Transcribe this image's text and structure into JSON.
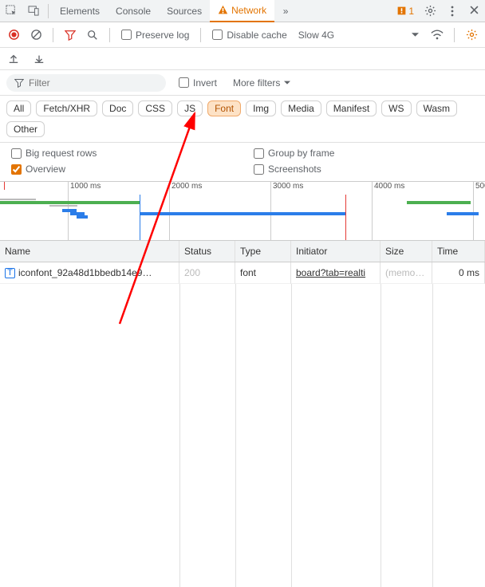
{
  "tabs": {
    "items": [
      "Elements",
      "Console",
      "Sources",
      "Network"
    ],
    "active": "Network",
    "more_icon": "»"
  },
  "issues": {
    "count": "1"
  },
  "toolbar": {
    "preserve_log": "Preserve log",
    "disable_cache": "Disable cache",
    "throttle": "Slow 4G"
  },
  "filter": {
    "placeholder": "Filter",
    "invert": "Invert",
    "more": "More filters"
  },
  "chips": [
    "All",
    "Fetch/XHR",
    "Doc",
    "CSS",
    "JS",
    "Font",
    "Img",
    "Media",
    "Manifest",
    "WS",
    "Wasm",
    "Other"
  ],
  "chip_active": "Font",
  "opts": {
    "big_rows": "Big request rows",
    "overview": "Overview",
    "group_frame": "Group by frame",
    "screenshots": "Screenshots"
  },
  "ruler": [
    "1000 ms",
    "2000 ms",
    "3000 ms",
    "4000 ms",
    "500"
  ],
  "columns": [
    "Name",
    "Status",
    "Type",
    "Initiator",
    "Size",
    "Time"
  ],
  "row": {
    "name": "iconfont_92a48d1bbedb14e9…",
    "status": "200",
    "type": "font",
    "initiator": "board?tab=realti",
    "size": "(memo…",
    "time": "0 ms"
  }
}
